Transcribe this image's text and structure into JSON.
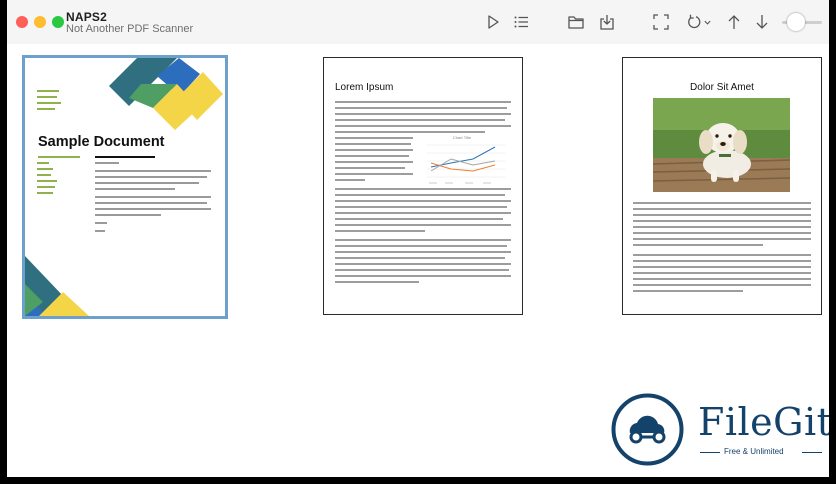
{
  "app": {
    "title": "NAPS2",
    "subtitle": "Not Another PDF Scanner"
  },
  "toolbar": {
    "buttons": [
      {
        "name": "scan-button",
        "icon": "play-icon"
      },
      {
        "name": "profiles-button",
        "icon": "list-icon"
      },
      {
        "name": "open-button",
        "icon": "folder-icon"
      },
      {
        "name": "import-button",
        "icon": "download-tray-icon"
      },
      {
        "name": "crop-button",
        "icon": "crop-icon"
      },
      {
        "name": "rotate-button",
        "icon": "rotate-icon"
      },
      {
        "name": "move-up-button",
        "icon": "arrow-up-icon"
      },
      {
        "name": "move-down-button",
        "icon": "arrow-down-icon"
      }
    ],
    "zoom": 0.2
  },
  "pages": [
    {
      "title": "Sample Document",
      "selected": true
    },
    {
      "title": "Lorem Ipsum",
      "chart_title": "Chart Title",
      "selected": false
    },
    {
      "title": "Dolor Sit Amet",
      "selected": false
    }
  ],
  "watermark": {
    "name": "FileGit",
    "tagline": "Free & Unlimited"
  },
  "colors": {
    "selection_border": "#6ea0cc",
    "watermark": "#13426b"
  }
}
